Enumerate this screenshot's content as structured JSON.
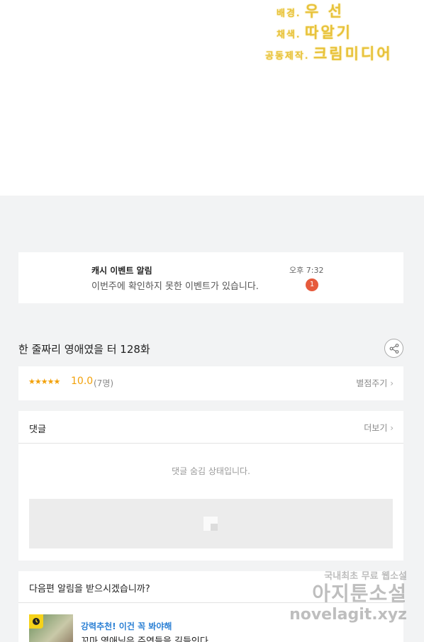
{
  "credits": [
    {
      "label": "배경.",
      "value": "우 선"
    },
    {
      "label": "채색.",
      "value": "따알기"
    },
    {
      "label": "공동제작.",
      "value": "크림미디어"
    }
  ],
  "notice": {
    "title": "캐시 이벤트 알림",
    "message": "이번주에 확인하지 못한 이벤트가 있습니다.",
    "time": "오후 7:32",
    "badge": "1"
  },
  "episode": {
    "title": "한 줄짜리 영애였을 터 128화"
  },
  "rating": {
    "stars": "★★★★★",
    "score": "10.0",
    "count": "(7명)",
    "rate_link": "별점주기"
  },
  "comments": {
    "title": "댓글",
    "more": "더보기",
    "hidden_message": "댓글 숨김 상태입니다."
  },
  "alarm": {
    "title": "다음편 알림을 받으시겠습니까?",
    "rec_label": "강력추천! 이건 꼭 봐야해",
    "rec_title": "꼬마 영애님은 주연들을 길들인다"
  },
  "watermark": {
    "line1": "국내최초 무료 웹소설",
    "line2": "아지툰소설",
    "line3": "novelagit.xyz"
  },
  "colors": {
    "accent_star": "#f2a10a",
    "badge": "#e65a3c",
    "link_blue": "#2a7fd4",
    "credit_gold": "#e8c23a"
  }
}
